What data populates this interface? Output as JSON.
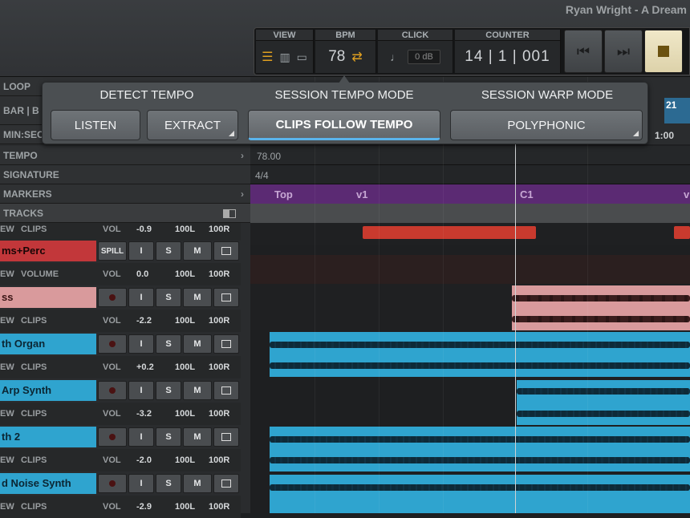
{
  "window": {
    "title": "Ryan Wright - A Dream"
  },
  "transport": {
    "view_label": "VIEW",
    "bpm_label": "BPM",
    "bpm_value": "78",
    "click_label": "CLICK",
    "click_db": "0 dB",
    "counter_label": "COUNTER",
    "counter_value": "14 | 1 | 001"
  },
  "tempo_popup": {
    "detect_title": "DETECT TEMPO",
    "session_mode_title": "SESSION TEMPO MODE",
    "warp_mode_title": "SESSION WARP MODE",
    "listen": "LISTEN",
    "extract": "EXTRACT",
    "clips_follow": "CLIPS FOLLOW TEMPO",
    "polyphonic": "POLYPHONIC"
  },
  "ruler": {
    "loop": "LOOP",
    "bar": "BAR | B",
    "minsec": "MIN:SEC",
    "tempo": "TEMPO",
    "signature": "SIGNATURE",
    "markers": "MARKERS",
    "tracks": "TRACKS",
    "bar_num": "21",
    "time_num": "1:00",
    "tempo_val": "78.00",
    "sig_val": "4/4"
  },
  "markers": [
    "Top",
    "v1",
    "C1",
    "v"
  ],
  "tracks": [
    {
      "name": "",
      "sub": "CLIPS",
      "vol": "-0.9",
      "pan_l": "100L",
      "pan_r": "100R",
      "color": "#2f3133"
    },
    {
      "name": "ms+Perc",
      "sub": "VOLUME",
      "vol": "0.0",
      "pan_l": "100L",
      "pan_r": "100R",
      "color": "#c2373a",
      "io": "SPILL"
    },
    {
      "name": "ss",
      "sub": "CLIPS",
      "vol": "-2.2",
      "pan_l": "100L",
      "pan_r": "100R",
      "color": "#d99a9c"
    },
    {
      "name": "th Organ",
      "sub": "CLIPS",
      "vol": "+0.2",
      "pan_l": "100L",
      "pan_r": "100R",
      "color": "#2fa4cf"
    },
    {
      "name": "Arp Synth",
      "sub": "CLIPS",
      "vol": "-3.2",
      "pan_l": "100L",
      "pan_r": "100R",
      "color": "#2fa4cf"
    },
    {
      "name": "th 2",
      "sub": "CLIPS",
      "vol": "-2.0",
      "pan_l": "100L",
      "pan_r": "100R",
      "color": "#2fa4cf"
    },
    {
      "name": "d Noise Synth",
      "sub": "CLIPS",
      "vol": "-2.9",
      "pan_l": "100L",
      "pan_r": "100R",
      "color": "#2fa4cf"
    }
  ],
  "buttons": {
    "input": "I",
    "solo": "S",
    "mute": "M",
    "vol": "VOL",
    "view": "EW"
  }
}
